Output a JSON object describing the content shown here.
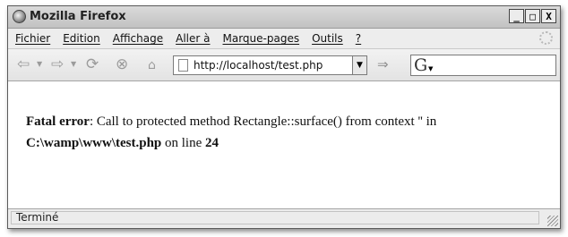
{
  "window": {
    "title": "Mozilla Firefox"
  },
  "window_controls": {
    "minimize": "_",
    "maximize": "□",
    "close": "X"
  },
  "menu": {
    "items": [
      {
        "label": "Fichier"
      },
      {
        "label": "Edition"
      },
      {
        "label": "Affichage"
      },
      {
        "label": "Aller à"
      },
      {
        "label": "Marque-pages"
      },
      {
        "label": "Outils"
      },
      {
        "label": "?"
      }
    ]
  },
  "navigation": {
    "back_icon": "back-arrow-icon",
    "forward_icon": "forward-arrow-icon",
    "reload_icon": "reload-icon",
    "stop_icon": "stop-icon",
    "go_icon": "go-icon",
    "url": "http://localhost/test.php",
    "search_engine_icon": "google-icon"
  },
  "content": {
    "error_label": "Fatal error",
    "error_message": ": Call to protected method Rectangle::surface() from context '' in",
    "error_file": "C:\\wamp\\www\\test.php",
    "error_on_line": " on line ",
    "error_line": "24"
  },
  "status": {
    "text": "Terminé"
  }
}
